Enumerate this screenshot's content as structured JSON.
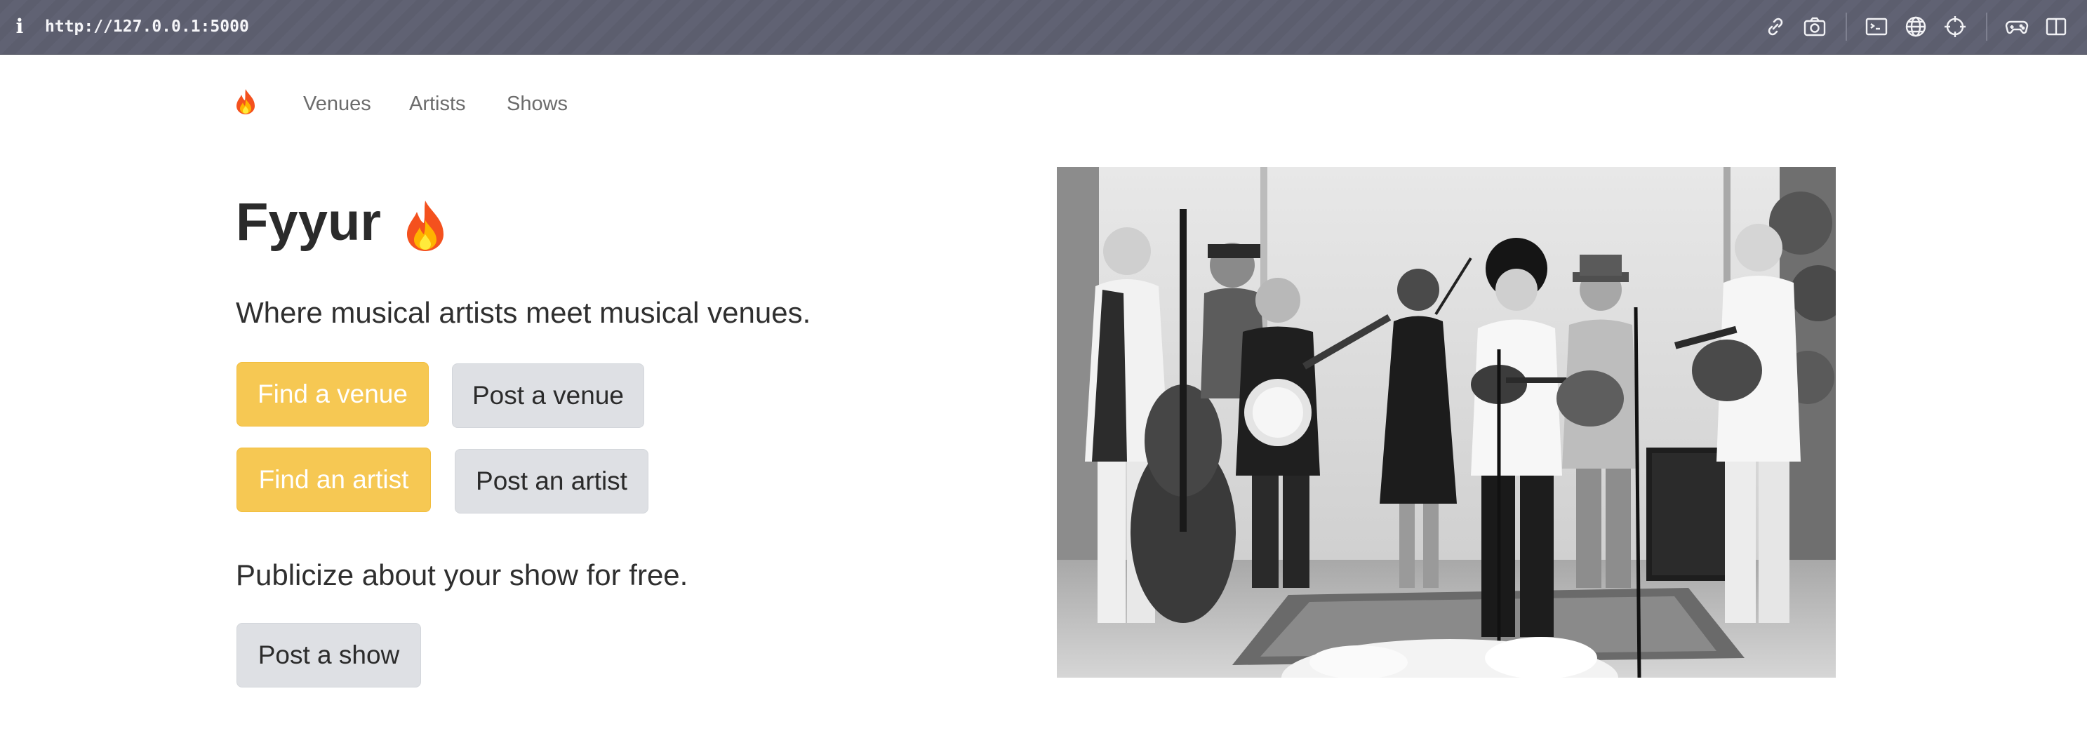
{
  "browser": {
    "info_icon": "info-icon",
    "url": "http://127.0.0.1:5000",
    "toolbar_icons": [
      "link-icon",
      "camera-icon",
      "terminal-icon",
      "globe-icon",
      "crosshair-icon",
      "gamepad-icon",
      "sidebar-icon"
    ]
  },
  "nav": {
    "brand_icon": "fire-emoji",
    "links": [
      {
        "label": "Venues"
      },
      {
        "label": "Artists"
      },
      {
        "label": "Shows"
      }
    ]
  },
  "hero": {
    "title": "Fyyur",
    "title_icon": "fire-emoji",
    "tagline": "Where musical artists meet musical venues.",
    "buttons": {
      "find_venue": "Find a venue",
      "post_venue": "Post a venue",
      "find_artist": "Find an artist",
      "post_artist": "Post an artist",
      "post_show": "Post a show"
    },
    "publicize": "Publicize about your show for free.",
    "image": "bluegrass-band-photo-grayscale"
  },
  "colors": {
    "browser_bar": "#5c5e6e",
    "warning": "#f6c853",
    "light": "#dee0e4",
    "text": "#2b2b2b",
    "nav_text": "#6c6c6c"
  }
}
